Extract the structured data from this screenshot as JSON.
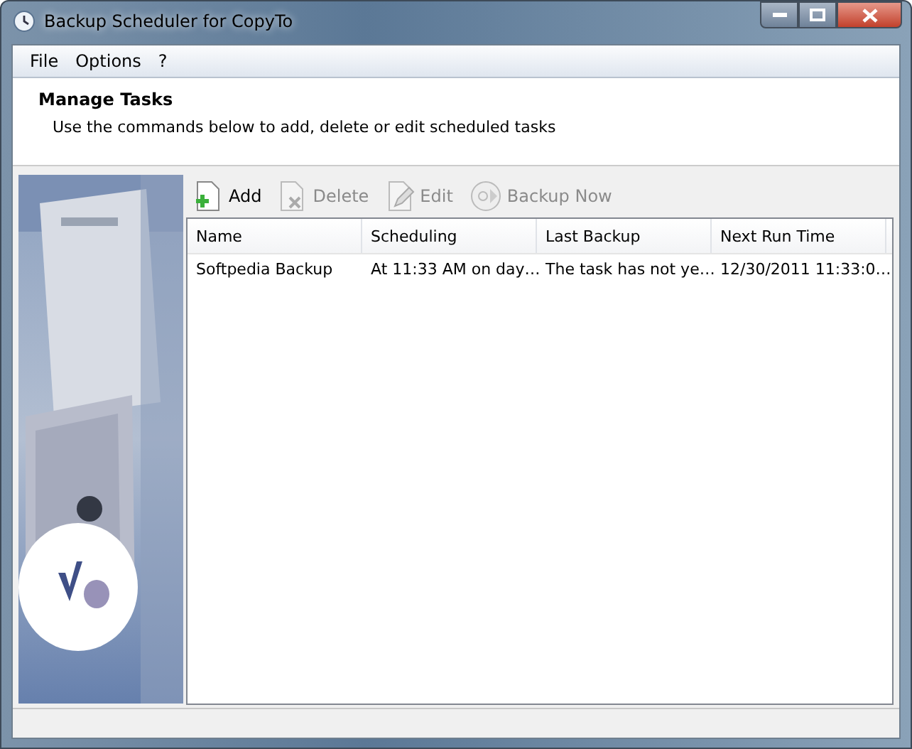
{
  "window": {
    "title": "Backup Scheduler for CopyTo"
  },
  "menu": [
    "File",
    "Options",
    "?"
  ],
  "header": {
    "title": "Manage Tasks",
    "subtitle": "Use the commands below to add, delete or edit scheduled tasks"
  },
  "banner": {
    "kind": "picture"
  },
  "toolbar": [
    {
      "label": "Add",
      "kind": "add",
      "disabled": false
    },
    {
      "label": "Delete",
      "kind": "delete",
      "disabled": true
    },
    {
      "label": "Edit",
      "kind": "edit",
      "disabled": true
    },
    {
      "label": "Backup Now",
      "kind": "run",
      "disabled": true
    }
  ],
  "table": {
    "columns": [
      "Name",
      "Scheduling",
      "Last Backup",
      "Next Run Time"
    ],
    "rows": [
      {
        "cells": [
          "Softpedia Backup",
          "At 11:33 AM on day…",
          "The task has not ye…",
          "12/30/2011 11:33:0…"
        ],
        "selected": false
      }
    ]
  }
}
